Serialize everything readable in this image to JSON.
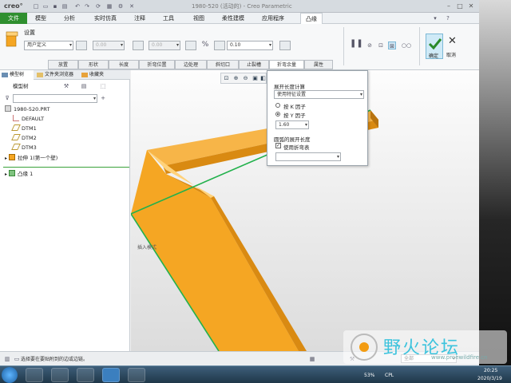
{
  "titlebar": {
    "logo": "creo°",
    "window_title": "1980-520 (活动的) - Creo Parametric"
  },
  "menubar": {
    "tabs": [
      "文件",
      "模型",
      "分析",
      "实时仿真",
      "注释",
      "工具",
      "视图",
      "柔性建模",
      "应用程序",
      "凸缘"
    ]
  },
  "ribbon": {
    "settings_label": "设置",
    "profile_value": "用户定义",
    "offset1_value": "0.00",
    "offset2_value": "0.00",
    "thickness_value": "0.10",
    "subtabs": [
      "放置",
      "形状",
      "长度",
      "折弯位置",
      "边处理",
      "斜切口",
      "止裂槽",
      "折弯余量",
      "属性"
    ],
    "confirm_label": "确定",
    "cancel_label": "取消"
  },
  "leftpanel": {
    "tabs": [
      "模型树",
      "文件夹浏览器",
      "收藏夹"
    ],
    "model_tree_label": "模型树",
    "items": [
      {
        "label": "1980-520.PRT"
      },
      {
        "label": "DEFAULT"
      },
      {
        "label": "DTM1"
      },
      {
        "label": "DTM2"
      },
      {
        "label": "DTM3"
      },
      {
        "label": "拉伸 1(第一个壁)"
      },
      {
        "label": "凸缘 1"
      }
    ]
  },
  "popup": {
    "section1_title": "展开长度计算",
    "method_value": "使用特征设置",
    "radio_k": "按 K 因子",
    "radio_y": "按 Y 因子",
    "y_value": "1.60",
    "section2_title": "圆弧的展开长度",
    "use_table_label": "使用折弯表"
  },
  "viewport": {
    "insert_mode": "插入模式"
  },
  "statusbar": {
    "message": "选择要在要贴附到的边或边链。",
    "filter_value": "全部"
  },
  "taskbar": {
    "lang": "CPL",
    "zoom": "53%",
    "time": "20:25",
    "date": "2020/3/19"
  },
  "watermark": {
    "text": "野火论坛",
    "sub": "www.proewildfire.cn"
  },
  "colors": {
    "file_tab": "#2f8f2f",
    "model": "#f5a623",
    "edge_highlight": "#22b14c",
    "confirm_bg": "#cfeaf7"
  }
}
